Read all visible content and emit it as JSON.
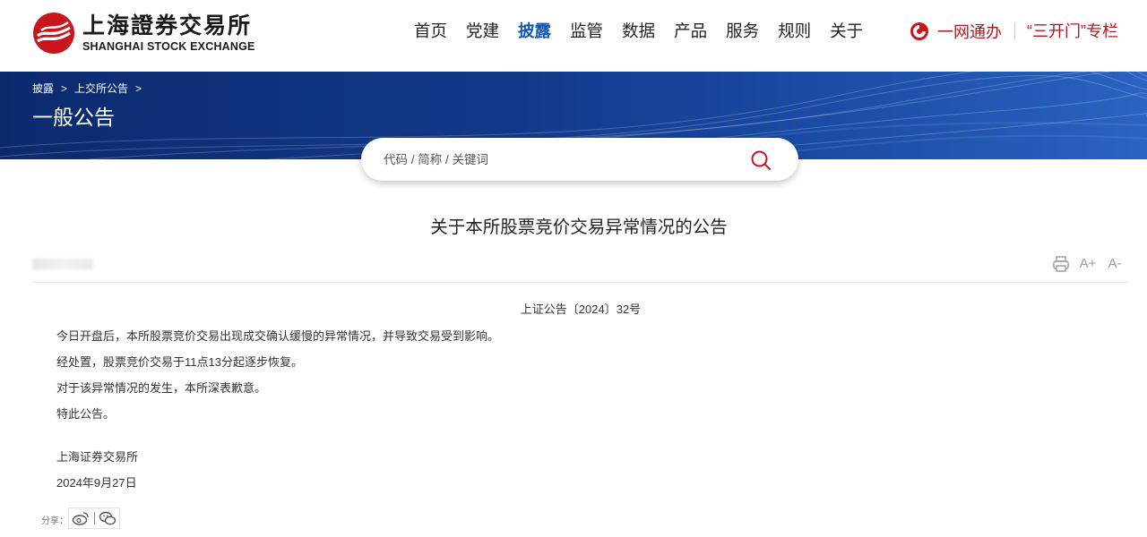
{
  "brand": {
    "name_cn": "上海證券交易所",
    "name_en": "SHANGHAI STOCK EXCHANGE",
    "red": "#b5171e",
    "accent_blue": "#1459b3"
  },
  "nav": {
    "items": [
      "首页",
      "党建",
      "披露",
      "监管",
      "数据",
      "产品",
      "服务",
      "规则",
      "关于"
    ],
    "active": "披露"
  },
  "top_links": {
    "yiwangtongban": "一网通办",
    "sankaimen": "“三开门”专栏"
  },
  "banner": {
    "breadcrumb": [
      "披露",
      "上交所公告"
    ],
    "breadcrumb_sep": ">",
    "title": "一般公告"
  },
  "search": {
    "placeholder": "代码 / 简称 / 关键词",
    "icon": "search-icon"
  },
  "article": {
    "title": "关于本所股票竞价交易异常情况的公告",
    "tools": {
      "print_icon": "printer-icon",
      "font_increase": "A+",
      "font_decrease": "A-"
    },
    "doc_number": "上证公告〔2024〕32号",
    "paragraphs": [
      "今日开盘后，本所股票竞价交易出现成交确认缓慢的异常情况，并导致交易受到影响。",
      "经处置，股票竞价交易于11点13分起逐步恢复。",
      "对于该异常情况的发生，本所深表歉意。",
      "特此公告。"
    ],
    "signature": "上海证券交易所",
    "date": "2024年9月27日"
  },
  "share": {
    "label": "分享：",
    "weibo_icon": "weibo-icon",
    "wechat_icon": "wechat-icon"
  }
}
